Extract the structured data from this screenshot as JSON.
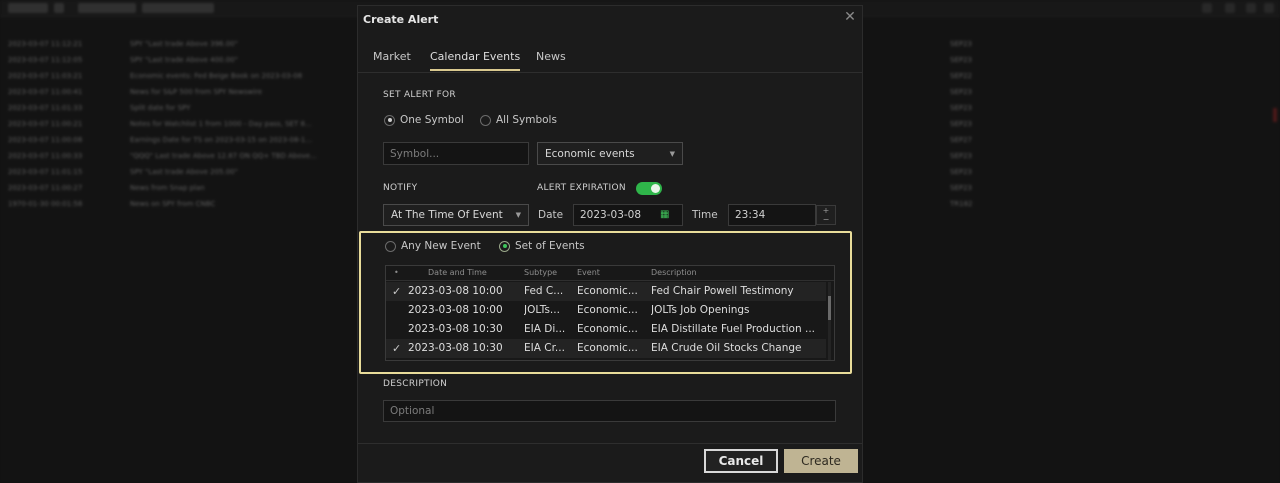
{
  "modal": {
    "title": "Create Alert",
    "close_icon": "close-icon",
    "tabs": [
      {
        "label": "Market",
        "active": false
      },
      {
        "label": "Calendar Events",
        "active": true
      },
      {
        "label": "News",
        "active": false
      }
    ],
    "set_alert_for": {
      "label": "SET ALERT FOR",
      "one_symbol": "One Symbol",
      "all_symbols": "All Symbols",
      "selected": "One Symbol",
      "symbol_placeholder": "Symbol...",
      "event_type": "Economic events"
    },
    "notify": {
      "label": "NOTIFY",
      "value": "At The Time Of Event"
    },
    "expiration": {
      "label": "ALERT EXPIRATION",
      "enabled": true,
      "date_label": "Date",
      "date_value": "2023-03-08",
      "time_label": "Time",
      "time_value": "23:34"
    },
    "event_scope": {
      "any_new": "Any New Event",
      "set_of": "Set of Events",
      "selected": "Set of Events"
    },
    "events_table": {
      "columns": [
        "•",
        "Date and Time",
        "Subtype",
        "Event",
        "Description"
      ],
      "rows": [
        {
          "checked": true,
          "datetime": "2023-03-08 10:00",
          "subtype": "Fed C...",
          "event": "Economic...",
          "description": "Fed Chair Powell Testimony"
        },
        {
          "checked": false,
          "datetime": "2023-03-08 10:00",
          "subtype": "JOLTs...",
          "event": "Economic...",
          "description": "JOLTs Job Openings"
        },
        {
          "checked": false,
          "datetime": "2023-03-08 10:30",
          "subtype": "EIA Di...",
          "event": "Economic...",
          "description": "EIA Distillate Fuel Production ..."
        },
        {
          "checked": true,
          "datetime": "2023-03-08 10:30",
          "subtype": "EIA Cr...",
          "event": "Economic...",
          "description": "EIA Crude Oil Stocks Change"
        }
      ]
    },
    "description": {
      "label": "DESCRIPTION",
      "placeholder": "Optional"
    },
    "buttons": {
      "cancel": "Cancel",
      "create": "Create"
    },
    "colors": {
      "highlight": "#e9dc9a",
      "toggle_on": "#2fb54a",
      "create_bg": "#bfb493"
    }
  }
}
